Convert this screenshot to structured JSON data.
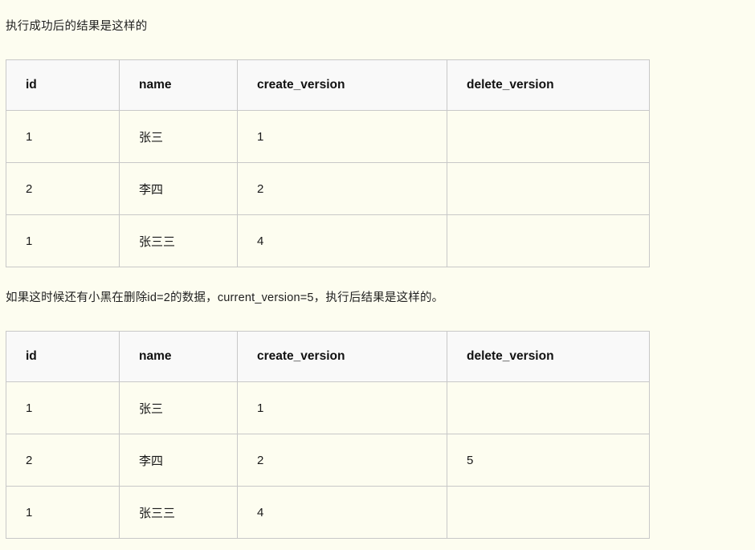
{
  "document": {
    "paragraph_1": "执行成功后的结果是这样的",
    "paragraph_2": "如果这时候还有小黑在删除id=2的数据，current_version=5，执行后结果是这样的。"
  },
  "tables": [
    {
      "caption_ref": "paragraph_1",
      "columns": [
        "id",
        "name",
        "create_version",
        "delete_version"
      ],
      "rows": [
        {
          "id": "1",
          "name": "张三",
          "create_version": "1",
          "delete_version": ""
        },
        {
          "id": "2",
          "name": "李四",
          "create_version": "2",
          "delete_version": ""
        },
        {
          "id": "1",
          "name": "张三三",
          "create_version": "4",
          "delete_version": ""
        }
      ]
    },
    {
      "caption_ref": "paragraph_2",
      "columns": [
        "id",
        "name",
        "create_version",
        "delete_version"
      ],
      "rows": [
        {
          "id": "1",
          "name": "张三",
          "create_version": "1",
          "delete_version": ""
        },
        {
          "id": "2",
          "name": "李四",
          "create_version": "2",
          "delete_version": "5"
        },
        {
          "id": "1",
          "name": "张三三",
          "create_version": "4",
          "delete_version": ""
        }
      ]
    }
  ],
  "colors": {
    "page_background": "#fdfdf0",
    "header_background": "#f9f9f9",
    "cell_background": "#fdfdf0",
    "border": "#c8c8c8",
    "text": "#1a1a1a"
  }
}
